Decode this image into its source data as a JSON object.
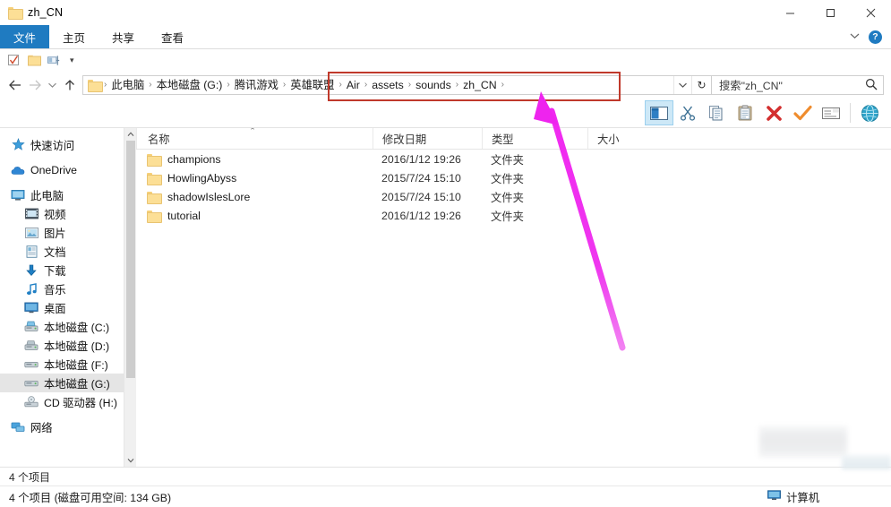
{
  "window": {
    "title": "zh_CN",
    "folder_icon": "folder-icon",
    "minimize": "—",
    "maximize": "□",
    "close": "✕"
  },
  "ribbon": {
    "tabs": [
      {
        "label": "文件",
        "active": true
      },
      {
        "label": "主页",
        "active": false
      },
      {
        "label": "共享",
        "active": false
      },
      {
        "label": "查看",
        "active": false
      }
    ],
    "collapse_icon": "chevron-down-icon",
    "help_icon": "help-icon",
    "help_label": "?"
  },
  "quick_access_toolbar": {
    "items": [
      {
        "name": "properties-icon"
      },
      {
        "name": "new-folder-icon"
      },
      {
        "name": "customize-view-icon"
      }
    ],
    "dropdown_label": "▾"
  },
  "navbar": {
    "back_label": "←",
    "forward_label": "→",
    "recent_label": "ˇ",
    "up_label": "↑",
    "breadcrumbs": [
      {
        "label": "此电脑",
        "highlighted": false
      },
      {
        "label": "本地磁盘 (G:)",
        "highlighted": false
      },
      {
        "label": "腾讯游戏",
        "highlighted": false
      },
      {
        "label": "英雄联盟",
        "highlighted": true
      },
      {
        "label": "Air",
        "highlighted": true
      },
      {
        "label": "assets",
        "highlighted": true
      },
      {
        "label": "sounds",
        "highlighted": true
      },
      {
        "label": "zh_CN",
        "highlighted": true
      }
    ],
    "separator": "›",
    "dropdown_label": "⌄",
    "refresh_label": "↻",
    "highlight_color": "#c0392b"
  },
  "search": {
    "placeholder": "搜索\"zh_CN\"",
    "value": "搜索\"zh_CN\"",
    "icon": "search-icon"
  },
  "command_strip": {
    "buttons": [
      {
        "name": "preview-pane-icon",
        "selected": true
      },
      {
        "name": "cut-icon",
        "selected": false
      },
      {
        "name": "copy-icon",
        "selected": false
      },
      {
        "name": "paste-icon",
        "selected": false
      },
      {
        "name": "delete-icon",
        "selected": false
      },
      {
        "name": "confirm-check-icon",
        "selected": false
      },
      {
        "name": "rename-icon",
        "selected": false
      },
      {
        "name": "globe-icon",
        "selected": false
      }
    ]
  },
  "sidebar": {
    "items": [
      {
        "label": "快速访问",
        "icon": "quick-access-star-icon",
        "indent": false,
        "selected": false,
        "group": true
      },
      {
        "label": "OneDrive",
        "icon": "onedrive-cloud-icon",
        "indent": false,
        "selected": false,
        "group": true
      },
      {
        "label": "此电脑",
        "icon": "this-pc-monitor-icon",
        "indent": false,
        "selected": false,
        "group": true
      },
      {
        "label": "视频",
        "icon": "videos-icon",
        "indent": true,
        "selected": false,
        "group": false
      },
      {
        "label": "图片",
        "icon": "pictures-icon",
        "indent": true,
        "selected": false,
        "group": false
      },
      {
        "label": "文档",
        "icon": "documents-icon",
        "indent": true,
        "selected": false,
        "group": false
      },
      {
        "label": "下载",
        "icon": "downloads-icon",
        "indent": true,
        "selected": false,
        "group": false
      },
      {
        "label": "音乐",
        "icon": "music-icon",
        "indent": true,
        "selected": false,
        "group": false
      },
      {
        "label": "桌面",
        "icon": "desktop-icon",
        "indent": true,
        "selected": false,
        "group": false
      },
      {
        "label": "本地磁盘 (C:)",
        "icon": "system-drive-icon",
        "indent": true,
        "selected": false,
        "group": false
      },
      {
        "label": "本地磁盘 (D:)",
        "icon": "system-drive-icon",
        "indent": true,
        "selected": false,
        "group": false
      },
      {
        "label": "本地磁盘 (F:)",
        "icon": "drive-icon",
        "indent": true,
        "selected": false,
        "group": false
      },
      {
        "label": "本地磁盘 (G:)",
        "icon": "drive-icon",
        "indent": true,
        "selected": true,
        "group": false
      },
      {
        "label": "CD 驱动器 (H:)",
        "icon": "cd-drive-icon",
        "indent": true,
        "selected": false,
        "group": false
      },
      {
        "label": "网络",
        "icon": "network-icon",
        "indent": false,
        "selected": false,
        "group": true
      }
    ],
    "scroll_up_label": "⌃",
    "scroll_down_label": "⌄"
  },
  "filelist": {
    "sort_indicator": "⌃",
    "columns": [
      {
        "key": "name",
        "label": "名称"
      },
      {
        "key": "date",
        "label": "修改日期"
      },
      {
        "key": "type",
        "label": "类型"
      },
      {
        "key": "size",
        "label": "大小"
      }
    ],
    "rows": [
      {
        "name": "champions",
        "date": "2016/1/12 19:26",
        "type": "文件夹",
        "size": "",
        "icon": "folder-icon"
      },
      {
        "name": "HowlingAbyss",
        "date": "2015/7/24 15:10",
        "type": "文件夹",
        "size": "",
        "icon": "folder-icon"
      },
      {
        "name": "shadowIslesLore",
        "date": "2015/7/24 15:10",
        "type": "文件夹",
        "size": "",
        "icon": "folder-icon"
      },
      {
        "name": "tutorial",
        "date": "2016/1/12 19:26",
        "type": "文件夹",
        "size": "",
        "icon": "folder-icon"
      }
    ]
  },
  "status": {
    "item_count": "4 个项目",
    "detail": "4 个项目 (磁盘可用空间: 134 GB)",
    "computer_label": "计算机",
    "computer_icon": "computer-icon"
  },
  "annotation": {
    "arrow_color": "#e81ce8",
    "arrow_name": "magenta-pointer-arrow",
    "highlight_box_name": "red-highlight-box"
  }
}
